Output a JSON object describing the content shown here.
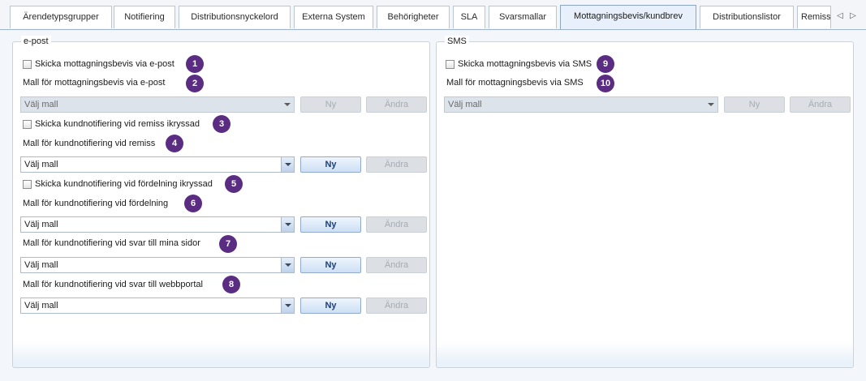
{
  "tabs": [
    {
      "label": "Ärendetypsgrupper"
    },
    {
      "label": "Notifiering"
    },
    {
      "label": "Distributionsnyckelord"
    },
    {
      "label": "Externa System"
    },
    {
      "label": "Behörigheter"
    },
    {
      "label": "SLA"
    },
    {
      "label": "Svarsmallar"
    },
    {
      "label": "Mottagningsbevis/kundbrev",
      "active": true
    },
    {
      "label": "Distributionslistor"
    },
    {
      "label": "Remiss"
    }
  ],
  "tab_nav": {
    "prev": "◁",
    "next": "▷"
  },
  "email_group": {
    "title": "e-post",
    "send_receipt": {
      "label": "Skicka mottagningsbevis via e-post",
      "checked": false,
      "badge": "1"
    },
    "receipt_template_label": {
      "text": "Mall för mottagningsbevis via e-post",
      "badge": "2"
    },
    "receipt_template": {
      "value": "Välj mall",
      "new": "Ny",
      "edit": "Ändra",
      "disabled": true
    },
    "send_referral": {
      "label": "Skicka kundnotifiering vid remiss ikryssad",
      "checked": false,
      "badge": "3"
    },
    "referral_template_label": {
      "text": "Mall för kundnotifiering vid remiss",
      "badge": "4"
    },
    "referral_template": {
      "value": "Välj mall",
      "new": "Ny",
      "edit": "Ändra"
    },
    "send_distribution": {
      "label": "Skicka kundnotifiering vid fördelning ikryssad",
      "checked": false,
      "badge": "5"
    },
    "distribution_template_label": {
      "text": "Mall för kundnotifiering vid fördelning",
      "badge": "6"
    },
    "distribution_template": {
      "value": "Välj mall",
      "new": "Ny",
      "edit": "Ändra"
    },
    "mypages_template_label": {
      "text": "Mall för kundnotifiering vid svar till mina sidor",
      "badge": "7"
    },
    "mypages_template": {
      "value": "Välj mall",
      "new": "Ny",
      "edit": "Ändra"
    },
    "webportal_template_label": {
      "text": "Mall för kundnotifiering vid svar till webbportal",
      "badge": "8"
    },
    "webportal_template": {
      "value": "Välj mall",
      "new": "Ny",
      "edit": "Ändra"
    }
  },
  "sms_group": {
    "title": "SMS",
    "send_receipt": {
      "label": "Skicka mottagningsbevis via SMS",
      "checked": false,
      "badge": "9"
    },
    "receipt_template_label": {
      "text": "Mall för mottagningsbevis via SMS",
      "badge": "10"
    },
    "receipt_template": {
      "value": "Välj mall",
      "new": "Ny",
      "edit": "Ändra",
      "disabled": true
    }
  },
  "colors": {
    "badge": "#5a2d82",
    "accent": "#1d3f7a",
    "panel_bg": "#f3f6fa"
  }
}
